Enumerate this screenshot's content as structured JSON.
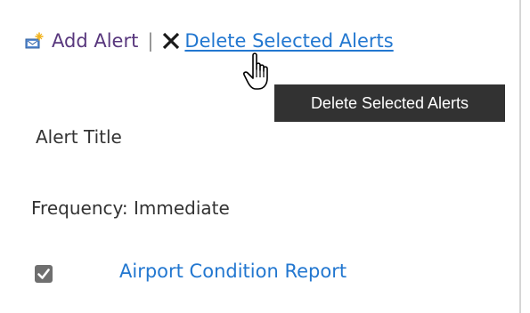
{
  "toolbar": {
    "add_icon": "add-alert-icon",
    "add_label": "Add Alert",
    "separator": "|",
    "delete_icon": "delete-x-icon",
    "delete_label": " Delete Selected Alerts",
    "colors": {
      "add_link": "#58377d",
      "delete_link": "#2277d0",
      "separator": "#8a8a8a"
    }
  },
  "tooltip": {
    "text": "Delete Selected Alerts",
    "background": "#323232"
  },
  "cursor": {
    "icon": "hand-pointer-cursor"
  },
  "alerts": {
    "column_header": "Alert Title",
    "frequency_label": "Frequency: Immediate",
    "items": [
      {
        "title": "Airport Condition Report",
        "checked": true,
        "checkbox_icon": "checkmark-icon"
      }
    ]
  }
}
